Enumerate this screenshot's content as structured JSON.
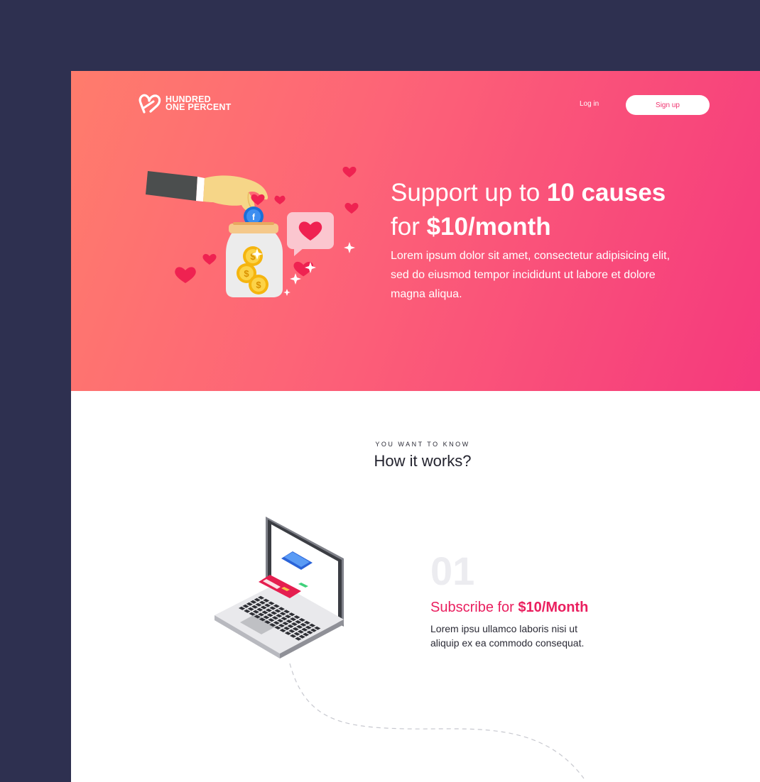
{
  "brand": {
    "name_line1": "HUNDRED",
    "name_line2": "ONE PERCENT"
  },
  "nav": {
    "login_label": "Log in",
    "signup_label": "Sign up"
  },
  "hero": {
    "title_part1": "Support up to ",
    "title_bold1": "10 causes",
    "title_part2": "for ",
    "title_bold2": "$10/month",
    "description": "Lorem ipsum dolor sit amet, consectetur adipisicing elit, sed do eiusmod tempor incididunt ut labore et dolore magna aliqua."
  },
  "how_it_works": {
    "eyebrow": "YOU WANT TO KNOW",
    "title": "How it works?",
    "steps": [
      {
        "number": "01",
        "title_part": "Subscribe for ",
        "title_bold": "$10/Month",
        "description": "Lorem ipsu ullamco laboris nisi ut aliquip ex ea commodo consequat."
      }
    ]
  },
  "colors": {
    "frame": "#2e3050",
    "hero_gradient_start": "#ff7c6c",
    "hero_gradient_end": "#f5397d",
    "accent": "#ea1f5f",
    "heart": "#ef2251",
    "coin": "#f5b50f"
  }
}
